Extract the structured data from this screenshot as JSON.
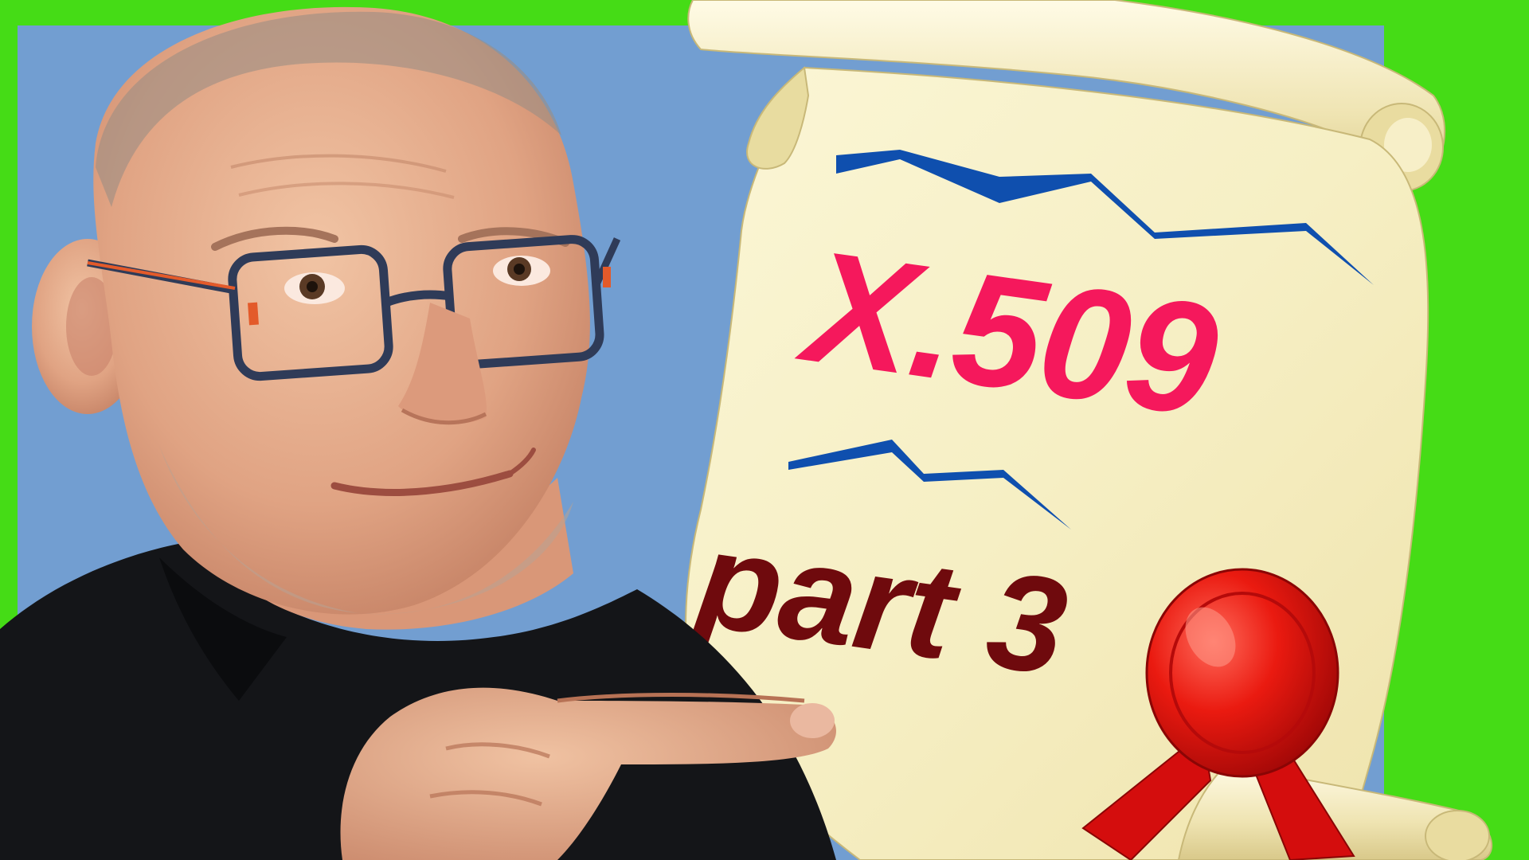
{
  "thumbnail": {
    "title": "X.509",
    "subtitle": "part 3"
  },
  "colors": {
    "border_green": "#45dc16",
    "panel_blue": "#729ed1",
    "parchment": "#f8f1c8",
    "title_pink": "#f5185c",
    "subtitle_maroon": "#6f0a0d",
    "scribble_blue": "#0f4fae",
    "seal_red": "#e81010"
  },
  "icons": {
    "seal": "wax-seal-icon",
    "scroll": "parchment-scroll"
  }
}
